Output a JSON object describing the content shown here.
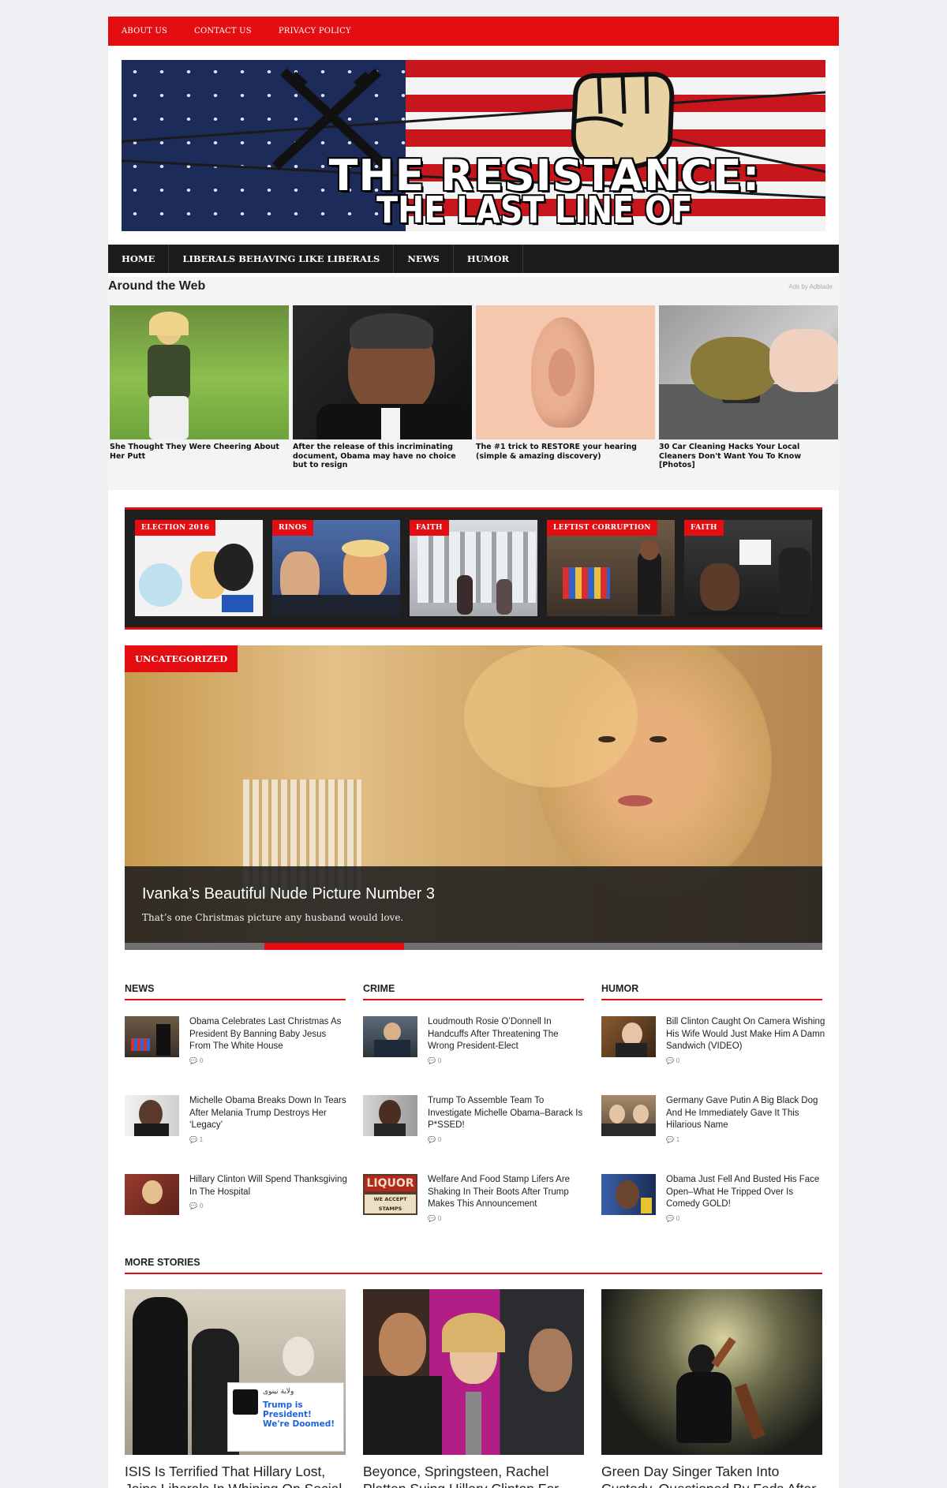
{
  "topnav": [
    "ABOUT US",
    "CONTACT US",
    "PRIVACY POLICY"
  ],
  "banner": {
    "line1": "THE RESISTANCE:",
    "line2": "THE LAST LINE OF DEFENSE"
  },
  "mainnav": [
    "HOME",
    "LIBERALS BEHAVING LIKE LIBERALS",
    "NEWS",
    "HUMOR"
  ],
  "around_web": {
    "heading": "Around the Web",
    "ads_by": "Ads by Adblade",
    "cards": [
      {
        "caption": "She Thought They Were Cheering About Her Putt"
      },
      {
        "caption": "After the release of this incriminating document, Obama may have no choice but to resign"
      },
      {
        "caption": "The #1 trick to RESTORE your hearing (simple & amazing discovery)"
      },
      {
        "caption": "30 Car Cleaning Hacks Your Local Cleaners Don't Want You To Know [Photos]"
      }
    ]
  },
  "featured_tags": [
    "ELECTION 2016",
    "RINOS",
    "FAITH",
    "LEFTIST CORRUPTION",
    "FAITH"
  ],
  "hero": {
    "tag": "UNCATEGORIZED",
    "title": "Ivanka’s Beautiful Nude Picture Number 3",
    "excerpt": "That’s one Christmas picture any husband would love."
  },
  "columns": [
    {
      "heading": "NEWS",
      "items": [
        {
          "title": "Obama Celebrates Last Christmas As President By Banning Baby Jesus From The White House",
          "comments": "0"
        },
        {
          "title": "Michelle Obama Breaks Down In Tears After Melania Trump Destroys Her ‘Legacy’",
          "comments": "1"
        },
        {
          "title": "Hillary Clinton Will Spend Thanksgiving In The Hospital",
          "comments": "0"
        }
      ]
    },
    {
      "heading": "CRIME",
      "items": [
        {
          "title": "Loudmouth Rosie O’Donnell In Handcuffs After Threatening The Wrong President-Elect",
          "comments": "0"
        },
        {
          "title": "Trump To Assemble Team To Investigate Michelle Obama–Barack Is P*SSED!",
          "comments": "0"
        },
        {
          "title": "Welfare And Food Stamp Lifers Are Shaking In Their Boots After Trump Makes This Announcement",
          "comments": "0"
        }
      ]
    },
    {
      "heading": "HUMOR",
      "items": [
        {
          "title": "Bill Clinton Caught On Camera Wishing His Wife Would Just Make Him A Damn Sandwich (VIDEO)",
          "comments": "0"
        },
        {
          "title": "Germany Gave Putin A Big Black Dog And He Immediately Gave It This Hilarious Name",
          "comments": "1"
        },
        {
          "title": "Obama Just Fell And Busted His Face Open–What He Tripped Over Is Comedy GOLD!",
          "comments": "0"
        }
      ]
    }
  ],
  "more_stories": {
    "heading": "MORE STORIES",
    "tweet": {
      "arabic": "ولاية نينوى",
      "line": "Trump is President!",
      "line2": "We're Doomed!"
    },
    "liquor": "LIQUOR",
    "stamps": "WE ACCEPT STAMPS",
    "stories": [
      {
        "title": "ISIS Is Terrified That Hillary Lost, Joins Liberals In Whining On Social Media"
      },
      {
        "title": "Beyonce, Springsteen, Rachel Platten Suing Hillary Clinton For This Hilarious Reason"
      },
      {
        "title": "Green Day Singer Taken Into Custody, Questioned By Feds After Threatening Trump At AMA Party"
      }
    ]
  }
}
